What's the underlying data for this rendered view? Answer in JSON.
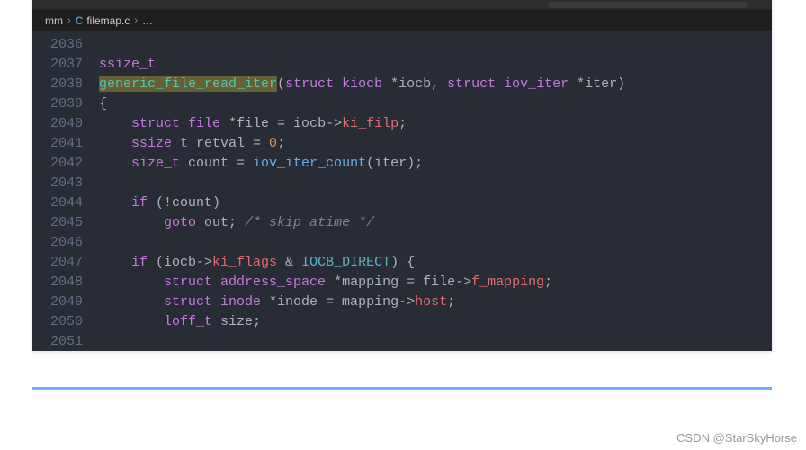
{
  "breadcrumbs": {
    "folder": "mm",
    "file": "filemap.c",
    "fileIconLetter": "C",
    "extra": "…"
  },
  "gutter": {
    "start": 2036,
    "end": 2051
  },
  "code": {
    "lines": [
      {
        "n": 2036,
        "tokens": []
      },
      {
        "n": 2037,
        "tokens": [
          {
            "t": "ssize_t",
            "c": "t-type"
          }
        ]
      },
      {
        "n": 2038,
        "tokens": [
          {
            "t": "generic_file_read_iter",
            "c": "t-hl"
          },
          {
            "t": "(",
            "c": "t-norm"
          },
          {
            "t": "struct",
            "c": "t-kw"
          },
          {
            "t": " kiocb ",
            "c": "t-type"
          },
          {
            "t": "*iocb",
            "c": "t-norm"
          },
          {
            "t": ", ",
            "c": "t-norm"
          },
          {
            "t": "struct",
            "c": "t-kw"
          },
          {
            "t": " iov_iter ",
            "c": "t-type"
          },
          {
            "t": "*iter",
            "c": "t-norm"
          },
          {
            "t": ")",
            "c": "t-norm"
          }
        ]
      },
      {
        "n": 2039,
        "tokens": [
          {
            "t": "{",
            "c": "t-norm"
          }
        ]
      },
      {
        "n": 2040,
        "tokens": [
          {
            "t": "    ",
            "c": "t-norm"
          },
          {
            "t": "struct",
            "c": "t-kw"
          },
          {
            "t": " file ",
            "c": "t-type"
          },
          {
            "t": "*file = iocb->",
            "c": "t-norm"
          },
          {
            "t": "ki_filp",
            "c": "t-field"
          },
          {
            "t": ";",
            "c": "t-norm"
          }
        ]
      },
      {
        "n": 2041,
        "tokens": [
          {
            "t": "    ",
            "c": "t-norm"
          },
          {
            "t": "ssize_t",
            "c": "t-type"
          },
          {
            "t": " retval = ",
            "c": "t-norm"
          },
          {
            "t": "0",
            "c": "t-num"
          },
          {
            "t": ";",
            "c": "t-norm"
          }
        ]
      },
      {
        "n": 2042,
        "tokens": [
          {
            "t": "    ",
            "c": "t-norm"
          },
          {
            "t": "size_t",
            "c": "t-type"
          },
          {
            "t": " count = ",
            "c": "t-norm"
          },
          {
            "t": "iov_iter_count",
            "c": "t-fn"
          },
          {
            "t": "(iter);",
            "c": "t-norm"
          }
        ]
      },
      {
        "n": 2043,
        "tokens": []
      },
      {
        "n": 2044,
        "tokens": [
          {
            "t": "    ",
            "c": "t-norm"
          },
          {
            "t": "if",
            "c": "t-kw"
          },
          {
            "t": " (!count)",
            "c": "t-norm"
          }
        ]
      },
      {
        "n": 2045,
        "tokens": [
          {
            "t": "        ",
            "c": "t-norm"
          },
          {
            "t": "goto",
            "c": "t-kw"
          },
          {
            "t": " out; ",
            "c": "t-norm"
          },
          {
            "t": "/* skip atime */",
            "c": "t-cmt"
          }
        ]
      },
      {
        "n": 2046,
        "tokens": []
      },
      {
        "n": 2047,
        "tokens": [
          {
            "t": "    ",
            "c": "t-norm"
          },
          {
            "t": "if",
            "c": "t-kw"
          },
          {
            "t": " (iocb->",
            "c": "t-norm"
          },
          {
            "t": "ki_flags",
            "c": "t-field"
          },
          {
            "t": " & ",
            "c": "t-norm"
          },
          {
            "t": "IOCB_DIRECT",
            "c": "t-const"
          },
          {
            "t": ") {",
            "c": "t-norm"
          }
        ]
      },
      {
        "n": 2048,
        "tokens": [
          {
            "t": "        ",
            "c": "t-norm"
          },
          {
            "t": "struct",
            "c": "t-kw"
          },
          {
            "t": " address_space ",
            "c": "t-type"
          },
          {
            "t": "*mapping = file->",
            "c": "t-norm"
          },
          {
            "t": "f_mapping",
            "c": "t-field"
          },
          {
            "t": ";",
            "c": "t-norm"
          }
        ]
      },
      {
        "n": 2049,
        "tokens": [
          {
            "t": "        ",
            "c": "t-norm"
          },
          {
            "t": "struct",
            "c": "t-kw"
          },
          {
            "t": " inode ",
            "c": "t-type"
          },
          {
            "t": "*inode = mapping->",
            "c": "t-norm"
          },
          {
            "t": "host",
            "c": "t-field"
          },
          {
            "t": ";",
            "c": "t-norm"
          }
        ]
      },
      {
        "n": 2050,
        "tokens": [
          {
            "t": "        ",
            "c": "t-norm"
          },
          {
            "t": "loff_t",
            "c": "t-type"
          },
          {
            "t": " size;",
            "c": "t-norm"
          }
        ]
      },
      {
        "n": 2051,
        "tokens": []
      }
    ]
  },
  "watermark": "CSDN @StarSkyHorse"
}
